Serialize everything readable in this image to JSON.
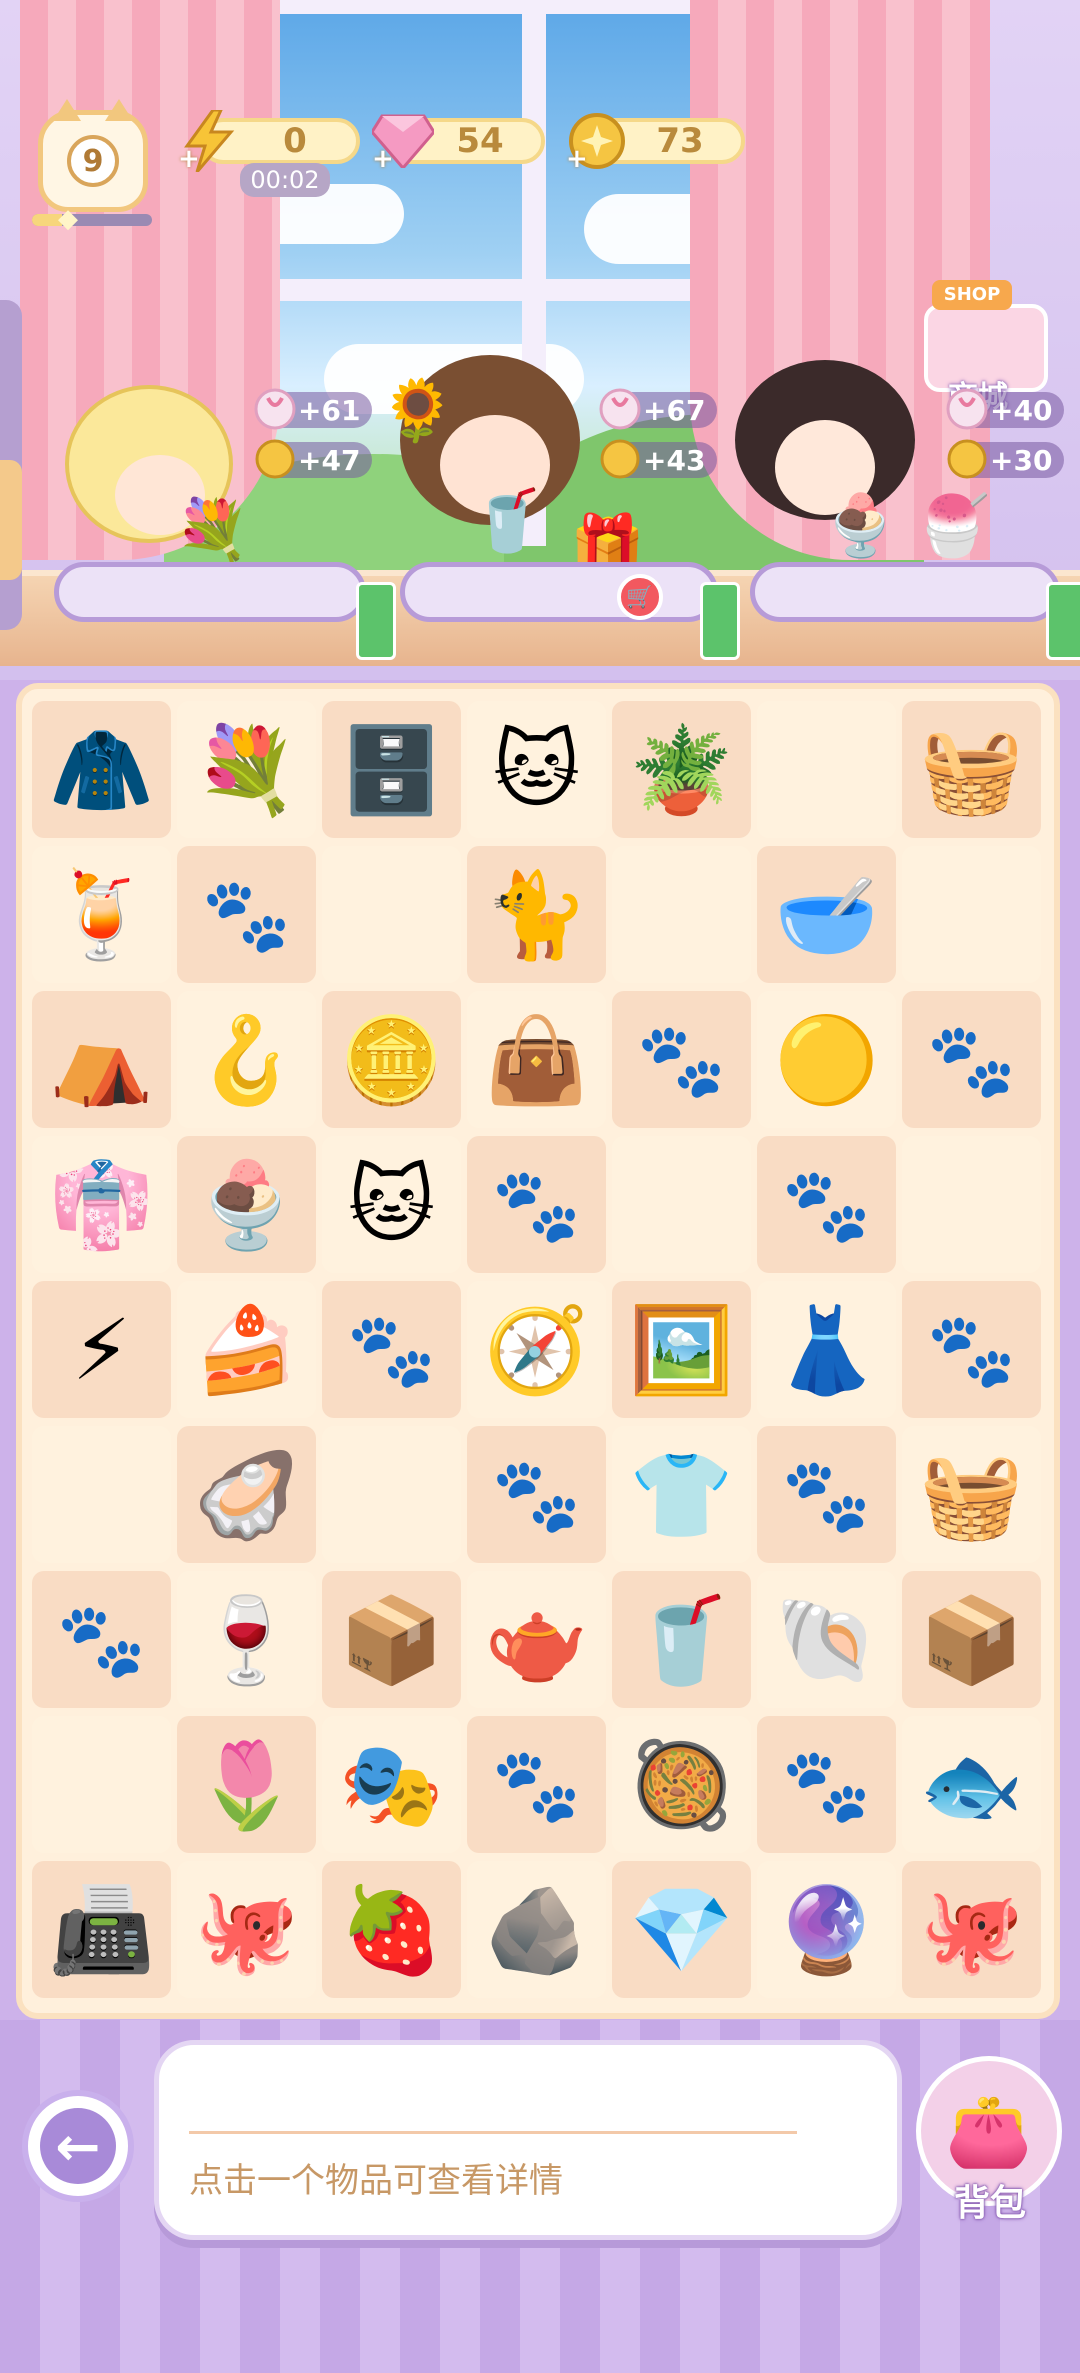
{
  "hud": {
    "level": "9",
    "level_progress": 0.25,
    "energy": {
      "value": "0",
      "timer": "00:02"
    },
    "gems": "54",
    "coins": "73",
    "shop": {
      "tag": "SHOP",
      "label": "商城"
    }
  },
  "customers": [
    {
      "name": "blonde-boy",
      "rewards": [
        "+61",
        "+47"
      ]
    },
    {
      "name": "sunflower-girl",
      "rewards": [
        "+67",
        "+43"
      ]
    },
    {
      "name": "glasses-boy",
      "rewards": [
        "+40",
        "+30"
      ]
    }
  ],
  "board": {
    "rows": 9,
    "cols": 7,
    "cells": [
      [
        "🧥",
        "💐",
        "🗄️",
        "🐱",
        "🪴",
        "",
        "🧺"
      ],
      [
        "🍹",
        "",
        "",
        "🐈",
        "",
        "🥣",
        ""
      ],
      [
        "⛺",
        "🪝",
        "🪙",
        "👜",
        "",
        "🟡",
        ""
      ],
      [
        "👘",
        "🍨",
        "🐱",
        "",
        "",
        "",
        ""
      ],
      [
        "⚡",
        "🍰",
        "",
        "🧭",
        "🖼️",
        "👗",
        ""
      ],
      [
        "",
        "🦪",
        "",
        "",
        "👕",
        "",
        "🧺"
      ],
      [
        "",
        "🍷",
        "📦",
        "🫖",
        "🥤",
        "🐚",
        "📦"
      ],
      [
        "",
        "🌷",
        "🎭",
        "",
        "🥘",
        "",
        "🐟"
      ],
      [
        "📠",
        "🐙",
        "🍓",
        "🪨",
        "💎",
        "🔮",
        "🐙"
      ]
    ]
  },
  "bottom": {
    "info_text": "点击一个物品可查看详情",
    "bag_label": "背包"
  },
  "colors": {
    "accent": "#a88ad8",
    "board_bg": "#fff0dc",
    "tile_dark": "#f9dcc4",
    "coin": "#f5c542"
  }
}
